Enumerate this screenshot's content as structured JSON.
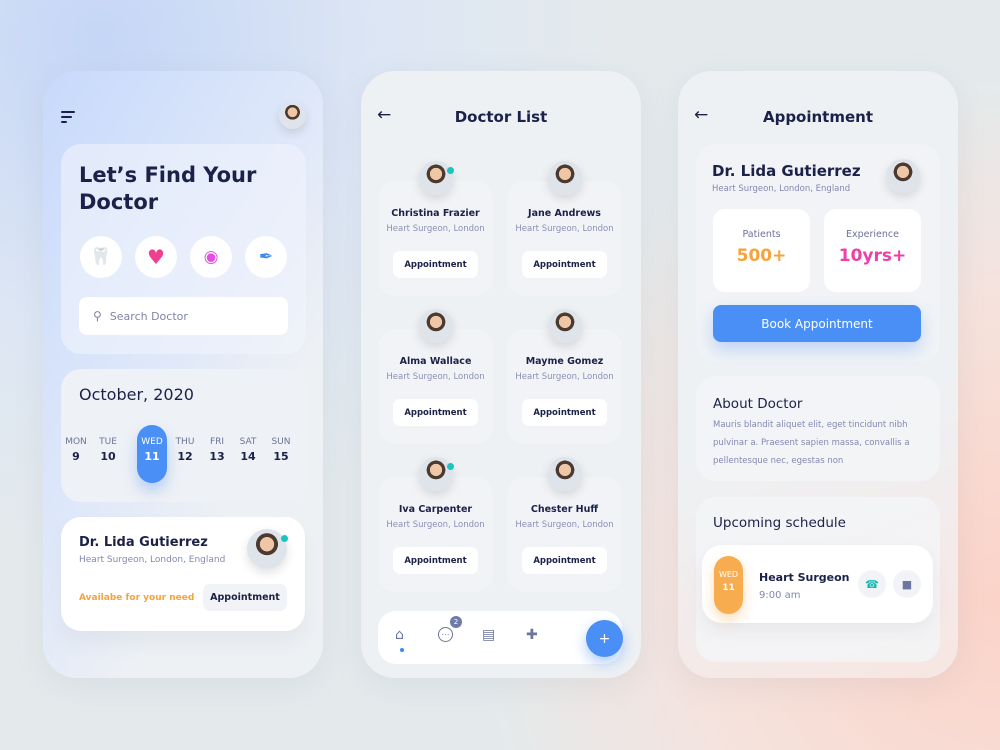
{
  "home": {
    "title": "Let’s Find Your Doctor",
    "title_l1": "Let’s Find Your",
    "title_l2": "Doctor",
    "categories": [
      {
        "name": "tooth",
        "glyph": "🦷",
        "color": "#f6a33b"
      },
      {
        "name": "heart",
        "glyph": "♥",
        "color": "#ef3f8f"
      },
      {
        "name": "eye",
        "glyph": "◉",
        "color": "#e44ee0"
      },
      {
        "name": "syringe",
        "glyph": "✒",
        "color": "#3f88f5"
      }
    ],
    "search_placeholder": "Search Doctor",
    "calendar": {
      "month": "October, 2020",
      "days": [
        {
          "n": "MON",
          "d": "9"
        },
        {
          "n": "TUE",
          "d": "10"
        },
        {
          "n": "WED",
          "d": "11",
          "selected": true
        },
        {
          "n": "THU",
          "d": "12"
        },
        {
          "n": "FRI",
          "d": "13"
        },
        {
          "n": "SAT",
          "d": "14"
        },
        {
          "n": "SUN",
          "d": "15"
        }
      ]
    },
    "doctor": {
      "name": "Dr. Lida Gutierrez",
      "specialty": "Heart Surgeon, London, England",
      "availability": "Availabe for your need",
      "button": "Appointment"
    }
  },
  "list": {
    "title": "Doctor List",
    "back": "←",
    "doctors": [
      {
        "name": "Christina Frazier",
        "specialty": "Heart Surgeon, London",
        "button": "Appointment",
        "online": true
      },
      {
        "name": "Jane Andrews",
        "specialty": "Heart Surgeon, London",
        "button": "Appointment",
        "online": false
      },
      {
        "name": "Alma Wallace",
        "specialty": "Heart Surgeon, London",
        "button": "Appointment",
        "online": false
      },
      {
        "name": "Mayme Gomez",
        "specialty": "Heart Surgeon, London",
        "button": "Appointment",
        "online": false
      },
      {
        "name": "Iva Carpenter",
        "specialty": "Heart Surgeon, London",
        "button": "Appointment",
        "online": true
      },
      {
        "name": "Chester Huff",
        "specialty": "Heart Surgeon, London",
        "button": "Appointment",
        "online": false
      }
    ],
    "nav": {
      "home": "⌂",
      "chat": "…",
      "chat_badge": "2",
      "records": "▤",
      "medkit": "✚",
      "fab": "+"
    }
  },
  "appointment": {
    "title": "Appointment",
    "back": "←",
    "doctor": {
      "name": "Dr. Lida Gutierrez",
      "specialty": "Heart Surgeon, London, England"
    },
    "stats": [
      {
        "label": "Patients",
        "value": "500+",
        "color": "#f6a33b"
      },
      {
        "label": "Experience",
        "value": "10yrs+",
        "color": "#ef3fa6"
      }
    ],
    "book_button": "Book Appointment",
    "about": {
      "title": "About Doctor",
      "text": "Mauris blandit aliquet elit, eget tincidunt nibh pulvinar a. Praesent sapien massa, convallis a pellentesque nec, egestas non"
    },
    "schedule": {
      "title": "Upcoming schedule",
      "day": "WED",
      "date": "11",
      "type": "Heart Surgeon",
      "time": "9:00 am",
      "call": "☎",
      "video": "■"
    }
  }
}
